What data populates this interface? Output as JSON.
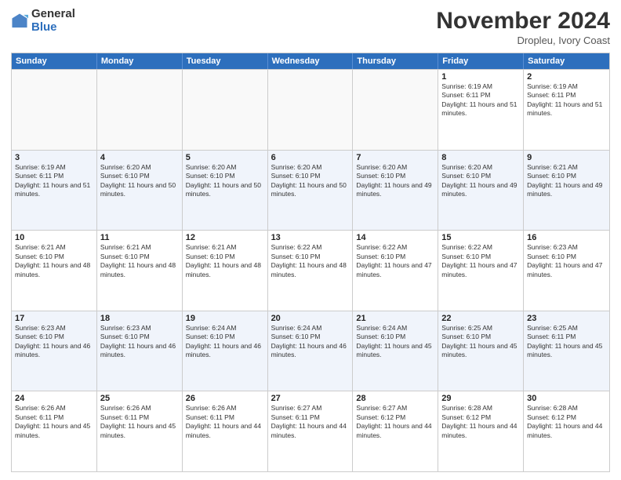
{
  "logo": {
    "general": "General",
    "blue": "Blue"
  },
  "header": {
    "month": "November 2024",
    "location": "Dropleu, Ivory Coast"
  },
  "weekdays": [
    "Sunday",
    "Monday",
    "Tuesday",
    "Wednesday",
    "Thursday",
    "Friday",
    "Saturday"
  ],
  "rows": [
    [
      {
        "day": "",
        "info": ""
      },
      {
        "day": "",
        "info": ""
      },
      {
        "day": "",
        "info": ""
      },
      {
        "day": "",
        "info": ""
      },
      {
        "day": "",
        "info": ""
      },
      {
        "day": "1",
        "info": "Sunrise: 6:19 AM\nSunset: 6:11 PM\nDaylight: 11 hours and 51 minutes."
      },
      {
        "day": "2",
        "info": "Sunrise: 6:19 AM\nSunset: 6:11 PM\nDaylight: 11 hours and 51 minutes."
      }
    ],
    [
      {
        "day": "3",
        "info": "Sunrise: 6:19 AM\nSunset: 6:11 PM\nDaylight: 11 hours and 51 minutes."
      },
      {
        "day": "4",
        "info": "Sunrise: 6:20 AM\nSunset: 6:10 PM\nDaylight: 11 hours and 50 minutes."
      },
      {
        "day": "5",
        "info": "Sunrise: 6:20 AM\nSunset: 6:10 PM\nDaylight: 11 hours and 50 minutes."
      },
      {
        "day": "6",
        "info": "Sunrise: 6:20 AM\nSunset: 6:10 PM\nDaylight: 11 hours and 50 minutes."
      },
      {
        "day": "7",
        "info": "Sunrise: 6:20 AM\nSunset: 6:10 PM\nDaylight: 11 hours and 49 minutes."
      },
      {
        "day": "8",
        "info": "Sunrise: 6:20 AM\nSunset: 6:10 PM\nDaylight: 11 hours and 49 minutes."
      },
      {
        "day": "9",
        "info": "Sunrise: 6:21 AM\nSunset: 6:10 PM\nDaylight: 11 hours and 49 minutes."
      }
    ],
    [
      {
        "day": "10",
        "info": "Sunrise: 6:21 AM\nSunset: 6:10 PM\nDaylight: 11 hours and 48 minutes."
      },
      {
        "day": "11",
        "info": "Sunrise: 6:21 AM\nSunset: 6:10 PM\nDaylight: 11 hours and 48 minutes."
      },
      {
        "day": "12",
        "info": "Sunrise: 6:21 AM\nSunset: 6:10 PM\nDaylight: 11 hours and 48 minutes."
      },
      {
        "day": "13",
        "info": "Sunrise: 6:22 AM\nSunset: 6:10 PM\nDaylight: 11 hours and 48 minutes."
      },
      {
        "day": "14",
        "info": "Sunrise: 6:22 AM\nSunset: 6:10 PM\nDaylight: 11 hours and 47 minutes."
      },
      {
        "day": "15",
        "info": "Sunrise: 6:22 AM\nSunset: 6:10 PM\nDaylight: 11 hours and 47 minutes."
      },
      {
        "day": "16",
        "info": "Sunrise: 6:23 AM\nSunset: 6:10 PM\nDaylight: 11 hours and 47 minutes."
      }
    ],
    [
      {
        "day": "17",
        "info": "Sunrise: 6:23 AM\nSunset: 6:10 PM\nDaylight: 11 hours and 46 minutes."
      },
      {
        "day": "18",
        "info": "Sunrise: 6:23 AM\nSunset: 6:10 PM\nDaylight: 11 hours and 46 minutes."
      },
      {
        "day": "19",
        "info": "Sunrise: 6:24 AM\nSunset: 6:10 PM\nDaylight: 11 hours and 46 minutes."
      },
      {
        "day": "20",
        "info": "Sunrise: 6:24 AM\nSunset: 6:10 PM\nDaylight: 11 hours and 46 minutes."
      },
      {
        "day": "21",
        "info": "Sunrise: 6:24 AM\nSunset: 6:10 PM\nDaylight: 11 hours and 45 minutes."
      },
      {
        "day": "22",
        "info": "Sunrise: 6:25 AM\nSunset: 6:10 PM\nDaylight: 11 hours and 45 minutes."
      },
      {
        "day": "23",
        "info": "Sunrise: 6:25 AM\nSunset: 6:11 PM\nDaylight: 11 hours and 45 minutes."
      }
    ],
    [
      {
        "day": "24",
        "info": "Sunrise: 6:26 AM\nSunset: 6:11 PM\nDaylight: 11 hours and 45 minutes."
      },
      {
        "day": "25",
        "info": "Sunrise: 6:26 AM\nSunset: 6:11 PM\nDaylight: 11 hours and 45 minutes."
      },
      {
        "day": "26",
        "info": "Sunrise: 6:26 AM\nSunset: 6:11 PM\nDaylight: 11 hours and 44 minutes."
      },
      {
        "day": "27",
        "info": "Sunrise: 6:27 AM\nSunset: 6:11 PM\nDaylight: 11 hours and 44 minutes."
      },
      {
        "day": "28",
        "info": "Sunrise: 6:27 AM\nSunset: 6:12 PM\nDaylight: 11 hours and 44 minutes."
      },
      {
        "day": "29",
        "info": "Sunrise: 6:28 AM\nSunset: 6:12 PM\nDaylight: 11 hours and 44 minutes."
      },
      {
        "day": "30",
        "info": "Sunrise: 6:28 AM\nSunset: 6:12 PM\nDaylight: 11 hours and 44 minutes."
      }
    ]
  ]
}
